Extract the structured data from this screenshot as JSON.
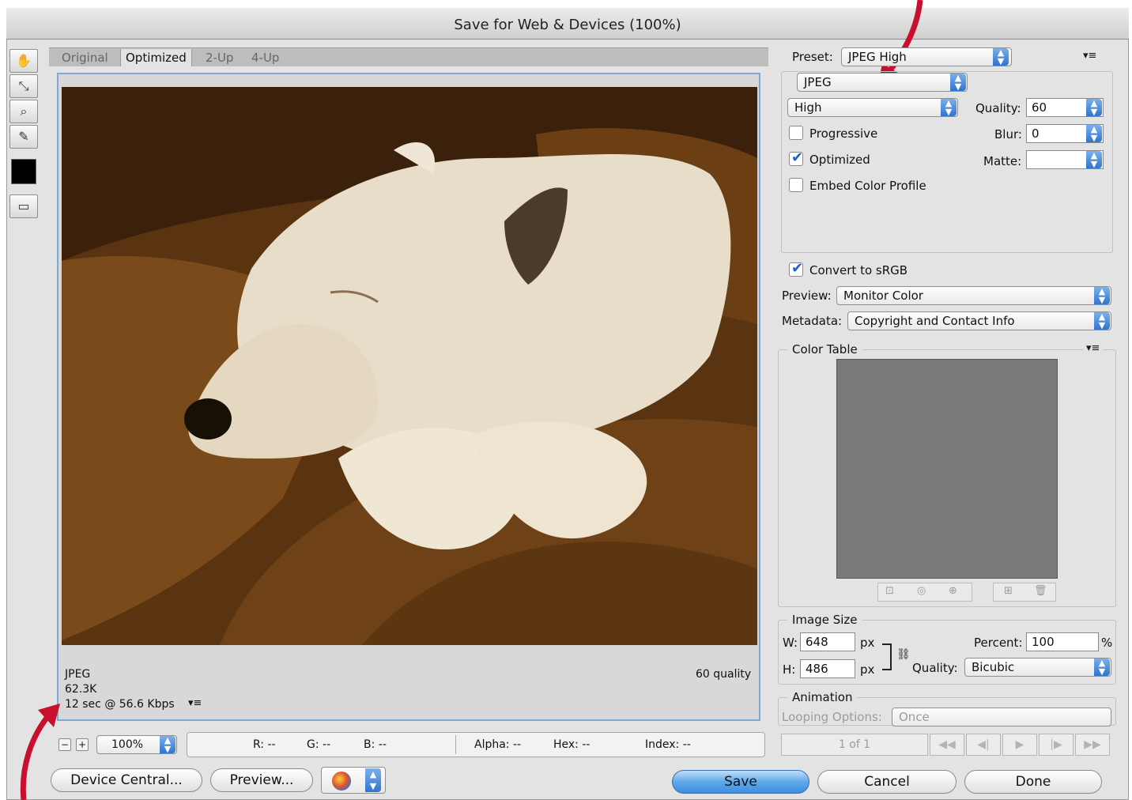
{
  "window": {
    "title": "Save for Web & Devices (100%)"
  },
  "tabs": [
    {
      "label": "Original"
    },
    {
      "label": "Optimized"
    },
    {
      "label": "2-Up"
    },
    {
      "label": "4-Up"
    }
  ],
  "tools": [
    "hand-icon",
    "slice-select-icon",
    "zoom-icon",
    "eyedropper-icon",
    "eyedropper-color-swatch",
    "toggle-slices-icon"
  ],
  "preview_info": {
    "format": "JPEG",
    "size": "62.3K",
    "download_time": "12 sec @ 56.6 Kbps",
    "quality": "60 quality"
  },
  "zoom": {
    "minus": "−",
    "plus": "+",
    "value": "100%"
  },
  "status": {
    "r": "R: --",
    "g": "G: --",
    "b": "B: --",
    "alpha": "Alpha: --",
    "hex": "Hex: --",
    "index": "Index: --"
  },
  "bottom_buttons": {
    "device_central": "Device Central...",
    "preview": "Preview...",
    "save": "Save",
    "cancel": "Cancel",
    "done": "Done"
  },
  "settings": {
    "preset_label": "Preset:",
    "preset_value": "JPEG High",
    "format_value": "JPEG",
    "compression_value": "High",
    "quality_label": "Quality:",
    "quality_value": "60",
    "blur_label": "Blur:",
    "blur_value": "0",
    "matte_label": "Matte:",
    "matte_value": "",
    "progressive_label": "Progressive",
    "progressive_checked": false,
    "optimized_label": "Optimized",
    "optimized_checked": true,
    "embed_label": "Embed Color Profile",
    "embed_checked": false,
    "srgb_label": "Convert to sRGB",
    "srgb_checked": true,
    "preview_label": "Preview:",
    "preview_value": "Monitor Color",
    "metadata_label": "Metadata:",
    "metadata_value": "Copyright and Contact Info"
  },
  "color_table": {
    "title": "Color Table"
  },
  "image_size": {
    "title": "Image Size",
    "w_label": "W:",
    "w_value": "648",
    "h_label": "H:",
    "h_value": "486",
    "unit": "px",
    "percent_label": "Percent:",
    "percent_value": "100",
    "percent_unit": "%",
    "quality_label": "Quality:",
    "quality_value": "Bicubic"
  },
  "animation": {
    "title": "Animation",
    "looping_label": "Looping Options:",
    "looping_value": "Once",
    "frame_counter": "1 of 1"
  },
  "colors": {
    "annotation_arrow": "#c8102e",
    "primary_button": "#5fa8ea"
  }
}
